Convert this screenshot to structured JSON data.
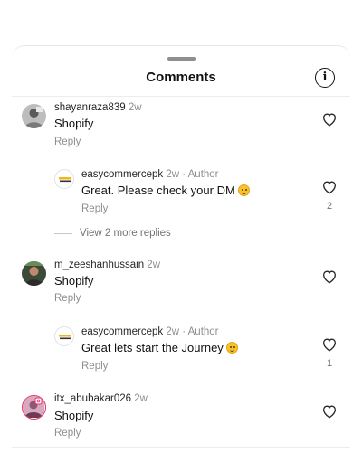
{
  "header": {
    "title": "Comments",
    "info_icon_glyph": "i"
  },
  "comments": [
    {
      "username": "shayanraza839",
      "time": "2w",
      "text": "Shopify",
      "reply_label": "Reply"
    },
    {
      "username": "m_zeeshanhussain",
      "time": "2w",
      "text": "Shopify",
      "reply_label": "Reply"
    },
    {
      "username": "itx_abubakar026",
      "time": "2w",
      "text": "Shopify",
      "reply_label": "Reply"
    }
  ],
  "replies": [
    {
      "username": "easycommercepk",
      "time": "2w",
      "author_tag": "Author",
      "text": "Great. Please check your DM",
      "reply_label": "Reply",
      "likes": "2"
    },
    {
      "username": "easycommercepk",
      "time": "2w",
      "author_tag": "Author",
      "text": "Great lets start the Journey",
      "reply_label": "Reply",
      "likes": "1"
    }
  ],
  "view_more": {
    "label": "View 2 more replies"
  }
}
